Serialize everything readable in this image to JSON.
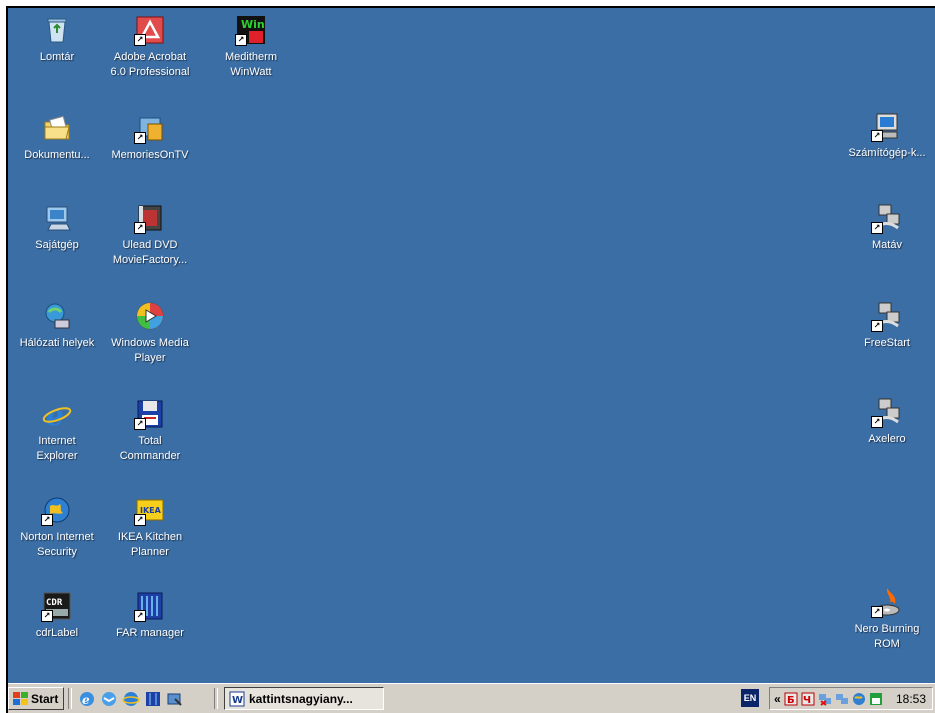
{
  "desktop": {
    "left_icons": [
      {
        "name": "recycle-bin-icon",
        "label": "Lomtár",
        "shortcut": false
      },
      {
        "name": "acrobat-icon",
        "label": "Adobe Acrobat\n6.0 Professional",
        "shortcut": true
      },
      {
        "name": "meditherm-icon",
        "label": "Meditherm\nWinWatt",
        "shortcut": true
      },
      {
        "name": "documents-folder-icon",
        "label": "Dokumentu...",
        "shortcut": false
      },
      {
        "name": "memoriesontv-icon",
        "label": "MemoriesOnTV",
        "shortcut": true
      },
      {
        "name": "my-computer-icon",
        "label": "Sajátgép",
        "shortcut": false
      },
      {
        "name": "ulead-dvd-icon",
        "label": "Ulead DVD\nMovieFactory...",
        "shortcut": true
      },
      {
        "name": "network-places-icon",
        "label": "Hálózati helyek",
        "shortcut": false
      },
      {
        "name": "windows-media-player-icon",
        "label": "Windows Media\nPlayer",
        "shortcut": false
      },
      {
        "name": "internet-explorer-icon",
        "label": "Internet\nExplorer",
        "shortcut": false
      },
      {
        "name": "total-commander-icon",
        "label": "Total\nCommander",
        "shortcut": true
      },
      {
        "name": "norton-security-icon",
        "label": "Norton Internet\nSecurity",
        "shortcut": true
      },
      {
        "name": "ikea-planner-icon",
        "label": "IKEA Kitchen\nPlanner",
        "shortcut": true
      },
      {
        "name": "cdrlabel-icon",
        "label": "cdrLabel",
        "shortcut": true
      },
      {
        "name": "far-manager-icon",
        "label": "FAR manager",
        "shortcut": true
      }
    ],
    "right_icons": [
      {
        "name": "remote-computer-icon",
        "label": "Számítógép-k...",
        "shortcut": true
      },
      {
        "name": "dialup-matav-icon",
        "label": "Matáv",
        "shortcut": true
      },
      {
        "name": "dialup-freestart-icon",
        "label": "FreeStart",
        "shortcut": true
      },
      {
        "name": "dialup-axelero-icon",
        "label": "Axelero",
        "shortcut": true
      },
      {
        "name": "nero-burning-rom-icon",
        "label": "Nero Burning\nROM",
        "shortcut": true
      }
    ]
  },
  "taskbar": {
    "start_label": "Start",
    "task_label": "kattintsnagyiany...",
    "language": "EN",
    "clock": "18:53",
    "tray_chevron": "«"
  },
  "colors": {
    "desktop": "#3a6ea5",
    "taskbar": "#d4d0c8"
  }
}
